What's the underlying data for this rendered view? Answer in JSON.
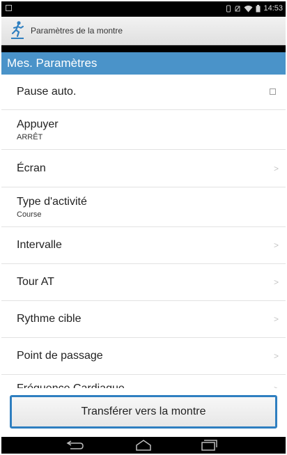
{
  "status_bar": {
    "time": "14:53",
    "icons": [
      "notification-icon",
      "vibrate-icon",
      "no-sim-icon",
      "wifi-icon",
      "battery-icon"
    ]
  },
  "app_bar": {
    "title": "Paramètres de la montre",
    "logo_icon": "runner-logo-icon"
  },
  "section": {
    "title": "Mes. Paramètres",
    "color": "#4a93c9"
  },
  "settings": [
    {
      "label": "Pause auto.",
      "sublabel": "",
      "control": "checkbox",
      "checked": false
    },
    {
      "label": "Appuyer",
      "sublabel": "ARRÊT",
      "control": "none"
    },
    {
      "label": "Écran",
      "sublabel": "",
      "control": "chevron"
    },
    {
      "label": "Type d'activité",
      "sublabel": "Course",
      "control": "none"
    },
    {
      "label": "Intervalle",
      "sublabel": "",
      "control": "chevron"
    },
    {
      "label": "Tour AT",
      "sublabel": "",
      "control": "chevron"
    },
    {
      "label": "Rythme cible",
      "sublabel": "",
      "control": "chevron"
    },
    {
      "label": "Point de passage",
      "sublabel": "",
      "control": "chevron"
    },
    {
      "label": "Fréquence Cardiaque",
      "sublabel": "",
      "control": "chevron"
    }
  ],
  "chevron_glyph": ">",
  "transfer_button": {
    "label": "Transférer vers la montre",
    "highlight_color": "#2f7fc0"
  },
  "nav_bar": {
    "buttons": [
      "back-icon",
      "home-icon",
      "recent-apps-icon"
    ]
  }
}
